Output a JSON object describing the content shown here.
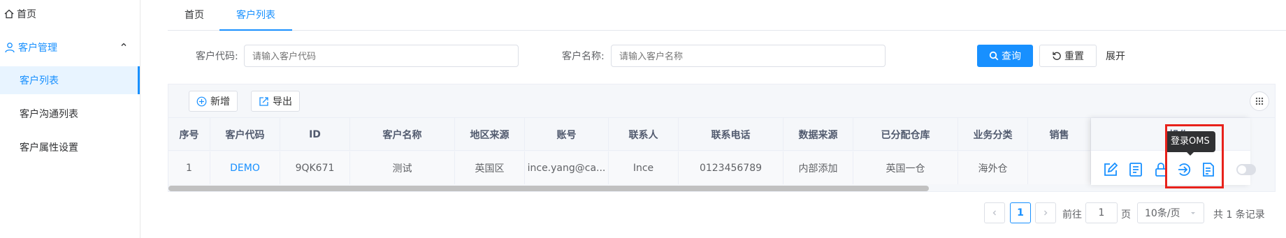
{
  "sidebar": {
    "home": "首页",
    "group": "客户管理",
    "items": [
      {
        "label": "客户列表",
        "active": true
      },
      {
        "label": "客户沟通列表",
        "active": false
      },
      {
        "label": "客户属性设置",
        "active": false
      }
    ]
  },
  "tabs": [
    {
      "label": "首页",
      "active": false
    },
    {
      "label": "客户列表",
      "active": true
    }
  ],
  "filters": {
    "customer_code": {
      "label": "客户代码:",
      "placeholder": "请输入客户代码"
    },
    "customer_name": {
      "label": "客户名称:",
      "placeholder": "请输入客户名称"
    },
    "search_label": "查询",
    "reset_label": "重置",
    "expand_label": "展开"
  },
  "toolbar": {
    "add_label": "新增",
    "export_label": "导出"
  },
  "table": {
    "columns": [
      "序号",
      "客户代码",
      "ID",
      "客户名称",
      "地区来源",
      "账号",
      "联系人",
      "联系电话",
      "数据来源",
      "已分配仓库",
      "业务分类",
      "销售"
    ],
    "action_column": "操作",
    "rows": [
      [
        "1",
        "DEMO",
        "9QK671",
        "测试",
        "英国区",
        "ince.yang@ca...",
        "Ince",
        "0123456789",
        "内部添加",
        "英国一仓",
        "海外仓",
        ""
      ]
    ]
  },
  "tooltip": "登录OMS",
  "pagination": {
    "current": "1",
    "goto_prefix": "前往",
    "goto_value": "1",
    "goto_suffix": "页",
    "page_size": "10条/页",
    "total": "共 1 条记录"
  },
  "colors": {
    "accent": "#1890ff",
    "highlight": "#e8221b"
  }
}
